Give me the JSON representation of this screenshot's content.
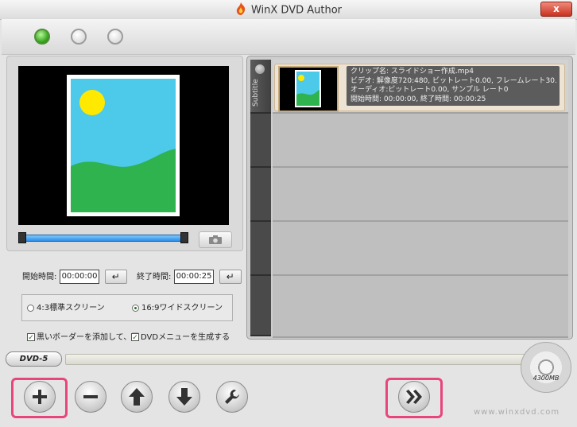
{
  "app": {
    "title": "WinX DVD Author"
  },
  "window": {
    "close_label": "x"
  },
  "steps": [
    {
      "state": "active"
    },
    {
      "state": "inactive"
    },
    {
      "state": "inactive"
    }
  ],
  "preview": {
    "camera_icon": "camera-icon"
  },
  "time": {
    "start_label": "開始時間:",
    "start_value": "00:00:00",
    "end_label": "終了時間:",
    "end_value": "00:00:25",
    "enter_glyph": "↵"
  },
  "aspect": {
    "option_4_3": "4:3標準スクリーン",
    "option_16_9": "16:9ワイドスクリーン",
    "selected": "16:9ワイドスクリーン"
  },
  "options": {
    "black_border": "黒いボーダーを添加して、画",
    "dvd_menu": "DVDメニューを生成する"
  },
  "sidebar_tab": {
    "label": "Subtitle"
  },
  "clip": {
    "line1": "クリップ名:  スライドショー作成.mp4",
    "line2": "ビデオ:  解像度720:480, ビットレート0.00, フレームレート30.",
    "line3": "オーディオ:ビットレート0.00, サンプル  レート0",
    "line4": "開始時間:  00:00:00, 終了時間:  00:00:25"
  },
  "disc": {
    "type": "DVD-5",
    "capacity": "4300MB"
  },
  "footer": {
    "website": "www.winxdvd.com"
  },
  "colors": {
    "highlight": "#e8457d",
    "step_active": "#36a51c"
  }
}
